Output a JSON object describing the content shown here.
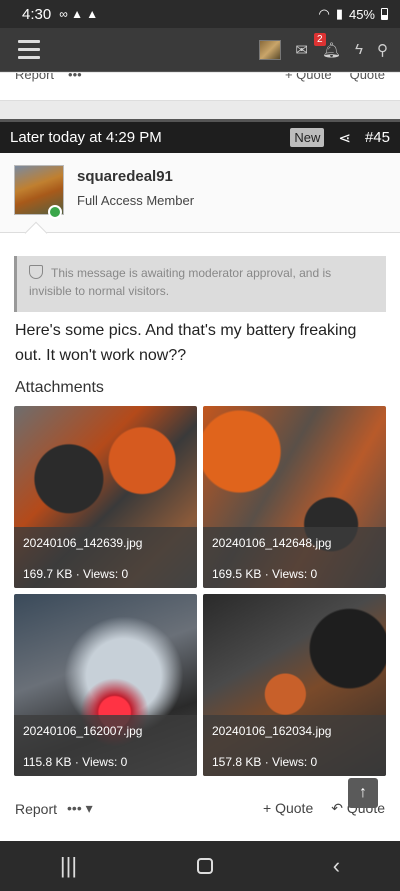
{
  "status_bar": {
    "time": "4:30",
    "icons_left": "∞ ▲ ▲",
    "battery": "45%"
  },
  "nav": {
    "notifications_count": "2"
  },
  "prev_post": {
    "report": "Report",
    "more": "•••",
    "quote1": "+ Quote",
    "quote2": "Quote"
  },
  "post": {
    "timestamp": "Later today at 4:29 PM",
    "new_badge": "New",
    "number": "#45",
    "username": "squaredeal91",
    "user_title": "Full Access Member",
    "notice": "This message is awaiting moderator approval, and is invisible to normal visitors.",
    "message": "Here's some pics. And that's my battery freaking out. It won't work now??",
    "attachments_label": "Attachments",
    "attachments": [
      {
        "filename": "20240106_142639.jpg",
        "size": "169.7 KB",
        "views": "Views: 0"
      },
      {
        "filename": "20240106_142648.jpg",
        "size": "169.5 KB",
        "views": "Views: 0"
      },
      {
        "filename": "20240106_162007.jpg",
        "size": "115.8 KB",
        "views": "Views: 0"
      },
      {
        "filename": "20240106_162034.jpg",
        "size": "157.8 KB",
        "views": "Views: 0"
      }
    ],
    "footer": {
      "report": "Report",
      "more": "•••",
      "quote": "+ Quote",
      "reply_quote": "Quote"
    }
  }
}
